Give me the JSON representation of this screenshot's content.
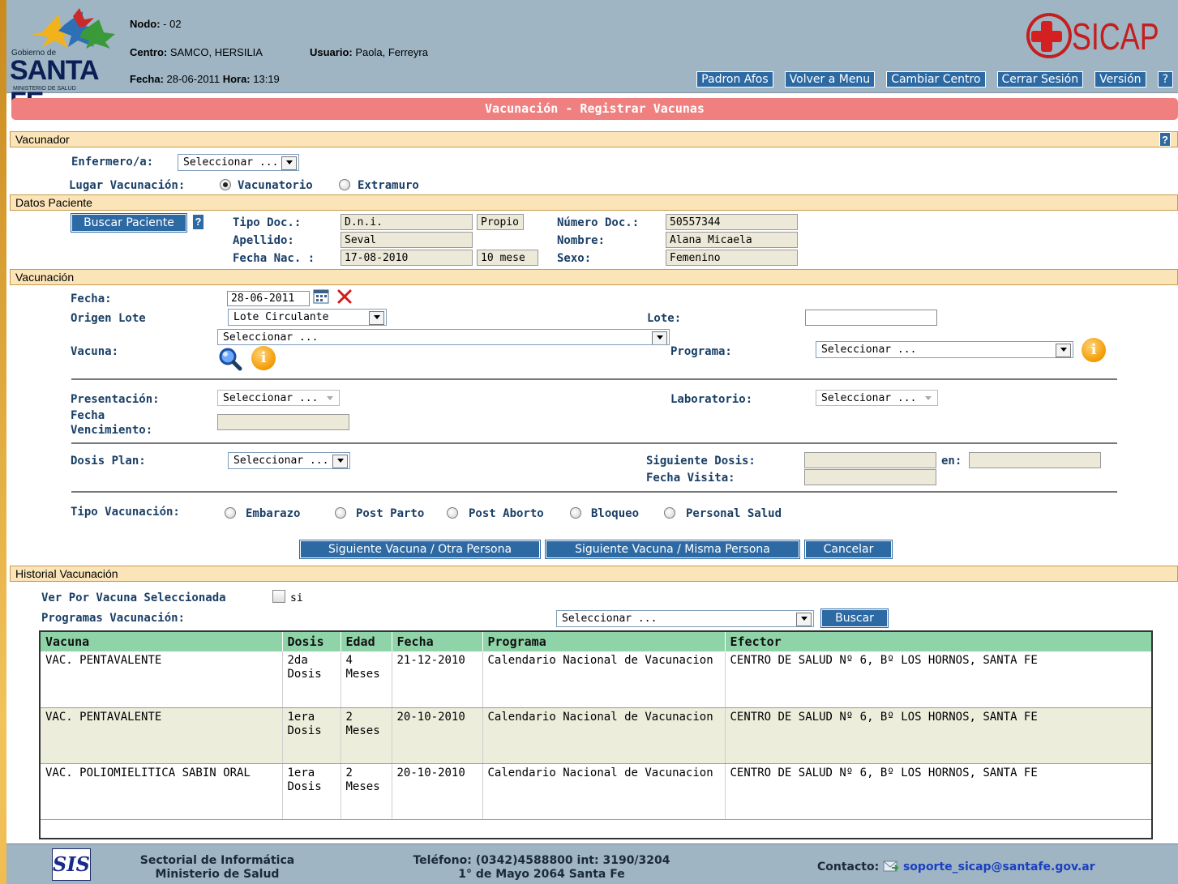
{
  "header": {
    "logo_small": "Gobierno de",
    "logo_big": "SANTA FE",
    "logo_ministry": "MINISTERIO DE SALUD",
    "nodo_label": "Nodo:",
    "nodo_value": " - 02",
    "centro_label": "Centro:",
    "centro_value": " SAMCO, HERSILIA",
    "usuario_label": "Usuario:",
    "usuario_value": " Paola, Ferreyra",
    "fecha_label": "Fecha:",
    "fecha_value": " 28-06-2011",
    "hora_label": "Hora:",
    "hora_value": " 13:19",
    "brand": "SICAP",
    "nav": [
      "Padron Afos",
      "Volver a Menu",
      "Cambiar Centro",
      "Cerrar Sesión",
      "Versión",
      "?"
    ]
  },
  "title": "Vacunación - Registrar Vacunas",
  "vacunador": {
    "section": "Vacunador",
    "help": "?",
    "enfermero_label": "Enfermero/a:",
    "enfermero_value": "Seleccionar ...",
    "lugar_label": "Lugar Vacunación:",
    "lugar_options": [
      "Vacunatorio",
      "Extramuro"
    ],
    "lugar_selected": "Vacunatorio"
  },
  "paciente": {
    "section": "Datos Paciente",
    "buscar_button": "Buscar Paciente",
    "help": "?",
    "tipo_doc_label": "Tipo Doc.:",
    "tipo_doc_value": "D.n.i.",
    "tipo_doc_extra": "Propio",
    "numero_doc_label": "Número Doc.:",
    "numero_doc_value": "50557344",
    "apellido_label": "Apellido:",
    "apellido_value": "Seval",
    "nombre_label": "Nombre:",
    "nombre_value": "Alana Micaela",
    "fecha_nac_label": "Fecha Nac. :",
    "fecha_nac_value": "17-08-2010",
    "edad_value": "10 mese",
    "sexo_label": "Sexo:",
    "sexo_value": "Femenino"
  },
  "vacunacion": {
    "section": "Vacunación",
    "fecha_label": "Fecha:",
    "fecha_value": "28-06-2011",
    "origen_label": "Origen Lote",
    "origen_value": "Lote Circulante",
    "lote_label": "Lote:",
    "lote_value": "",
    "vacuna_label": "Vacuna:",
    "vacuna_value": "Seleccionar ...",
    "programa_label": "Programa:",
    "programa_value": "Seleccionar ...",
    "presentacion_label": "Presentación:",
    "presentacion_value": "Seleccionar ...",
    "laboratorio_label": "Laboratorio:",
    "laboratorio_value": "Seleccionar ...",
    "fecha_venc_label_1": "Fecha",
    "fecha_venc_label_2": "Vencimiento:",
    "dosis_plan_label": "Dosis Plan:",
    "dosis_plan_value": "Seleccionar ...",
    "siguiente_dosis_label": "Siguiente Dosis:",
    "en_label": "en:",
    "fecha_visita_label": "Fecha Visita:",
    "tipo_label": "Tipo Vacunación:",
    "tipo_options": [
      "Embarazo",
      "Post Parto",
      "Post Aborto",
      "Bloqueo",
      "Personal Salud"
    ],
    "buttons": [
      "Siguiente Vacuna / Otra Persona",
      "Siguiente Vacuna / Misma Persona",
      "Cancelar"
    ]
  },
  "historial": {
    "section": "Historial Vacunación",
    "ver_label": "Ver Por Vacuna Seleccionada",
    "si_label": "si",
    "programas_label": "Programas Vacunación:",
    "programas_value": "Seleccionar ...",
    "buscar_button": "Buscar",
    "columns": [
      "Vacuna",
      "Dosis",
      "Edad",
      "Fecha",
      "Programa",
      "Efector"
    ],
    "rows": [
      {
        "vacuna": "VAC. PENTAVALENTE",
        "dosis": "2da Dosis",
        "edad": "4 Meses",
        "fecha": "21-12-2010",
        "programa": "Calendario Nacional de Vacunacion",
        "efector": "CENTRO DE SALUD Nº 6, Bº LOS HORNOS, SANTA FE"
      },
      {
        "vacuna": "VAC. PENTAVALENTE",
        "dosis": "1era Dosis",
        "edad": "2 Meses",
        "fecha": "20-10-2010",
        "programa": "Calendario Nacional de Vacunacion",
        "efector": "CENTRO DE SALUD Nº 6, Bº LOS HORNOS, SANTA FE"
      },
      {
        "vacuna": "VAC. POLIOMIELITICA SABIN ORAL",
        "dosis": "1era Dosis",
        "edad": "2 Meses",
        "fecha": "20-10-2010",
        "programa": "Calendario Nacional de Vacunacion",
        "efector": "CENTRO DE SALUD Nº 6, Bº LOS HORNOS, SANTA FE"
      }
    ]
  },
  "footer": {
    "logo": "SIS",
    "org_1": "Sectorial de Informática",
    "org_2": "Ministerio de Salud",
    "tel_1": "Teléfono: (0342)4588800 int: 3190/3204",
    "tel_2": "1° de Mayo 2064 Santa Fe",
    "contacto_label": "Contacto:",
    "contacto_email": "soporte_sicap@santafe.gov.ar"
  },
  "colors": {
    "header_bg": "#9fb5c4",
    "title_bar": "#f08080",
    "section_bg": "#fbe4b8",
    "button_blue": "#2d6aa3",
    "label_blue": "#1a3f66",
    "table_header": "#8fd4a8"
  },
  "icons": [
    "star-logo-icon",
    "red-cross-icon",
    "calendar-icon",
    "clear-x-icon",
    "search-magnifier-icon",
    "info-icon",
    "mail-icon"
  ]
}
